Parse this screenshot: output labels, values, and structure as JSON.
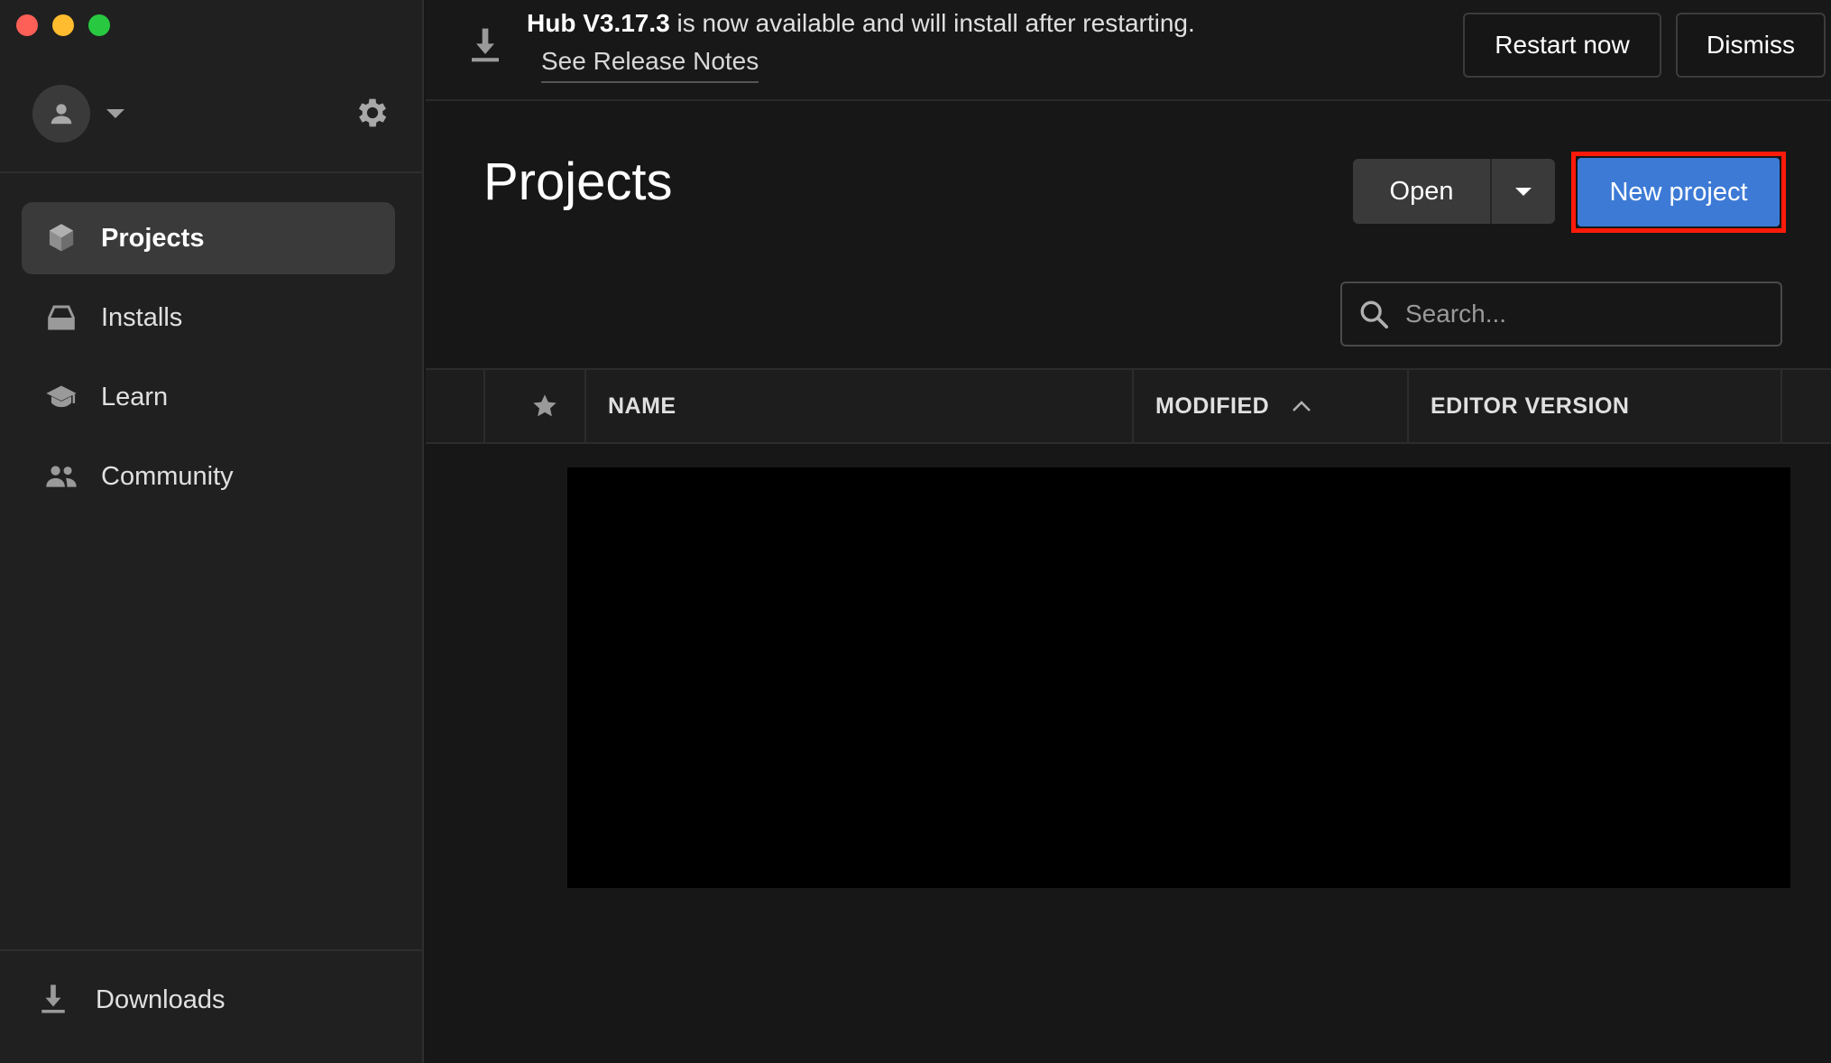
{
  "sidebar": {
    "nav": [
      {
        "label": "Projects",
        "icon": "cube-icon",
        "active": true
      },
      {
        "label": "Installs",
        "icon": "installs-icon",
        "active": false
      },
      {
        "label": "Learn",
        "icon": "graduation-cap-icon",
        "active": false
      },
      {
        "label": "Community",
        "icon": "people-icon",
        "active": false
      }
    ],
    "downloads_label": "Downloads"
  },
  "banner": {
    "version": "Hub V3.17.3",
    "message": " is now available and will install after restarting.",
    "release_notes": "See Release Notes",
    "restart_label": "Restart now",
    "dismiss_label": "Dismiss"
  },
  "main": {
    "title": "Projects",
    "open_label": "Open",
    "new_project_label": "New project",
    "search_placeholder": "Search..."
  },
  "table": {
    "columns": {
      "name": "NAME",
      "modified": "MODIFIED",
      "editor_version": "EDITOR VERSION"
    }
  },
  "colors": {
    "accent": "#3d7ad6",
    "highlight": "#ff1a0a"
  }
}
